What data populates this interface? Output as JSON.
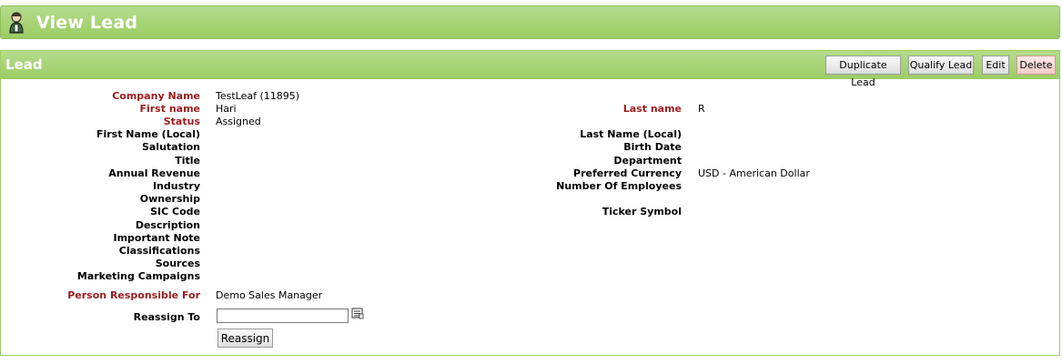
{
  "header": {
    "title": "View Lead",
    "icon": "person-icon"
  },
  "panel": {
    "title": "Lead",
    "buttons": {
      "duplicate": "Duplicate Lead",
      "qualify": "Qualify Lead",
      "edit": "Edit",
      "delete": "Delete"
    }
  },
  "fields_left": [
    {
      "label": "Company Name",
      "value": "TestLeaf (11895)",
      "required": true
    },
    {
      "label": "First name",
      "value": "Hari",
      "required": true
    },
    {
      "label": "Status",
      "value": "Assigned",
      "required": true
    },
    {
      "label": "First Name (Local)",
      "value": ""
    },
    {
      "label": "Salutation",
      "value": ""
    },
    {
      "label": "Title",
      "value": ""
    },
    {
      "label": "Annual Revenue",
      "value": ""
    },
    {
      "label": "Industry",
      "value": ""
    },
    {
      "label": "Ownership",
      "value": ""
    },
    {
      "label": "SIC Code",
      "value": ""
    },
    {
      "label": "Description",
      "value": ""
    },
    {
      "label": "Important Note",
      "value": ""
    },
    {
      "label": "Classifications",
      "value": ""
    },
    {
      "label": "Sources",
      "value": ""
    },
    {
      "label": "Marketing Campaigns",
      "value": ""
    }
  ],
  "fields_right": [
    {
      "label": "Last name",
      "value": "R",
      "required": true
    },
    {
      "label": "Last Name (Local)",
      "value": ""
    },
    {
      "label": "Birth Date",
      "value": ""
    },
    {
      "label": "Department",
      "value": ""
    },
    {
      "label": "Preferred Currency",
      "value": "USD - American Dollar"
    },
    {
      "label": "Number Of Employees",
      "value": ""
    },
    {
      "label": "Ticker Symbol",
      "value": ""
    }
  ],
  "responsible": {
    "label": "Person Responsible For",
    "value": "Demo Sales Manager"
  },
  "reassign": {
    "label": "Reassign To",
    "input_value": "",
    "button": "Reassign",
    "lookup_icon": "lookup-icon"
  },
  "colors": {
    "header_green": "#9ccc63",
    "required_label": "#9b1c1c"
  }
}
